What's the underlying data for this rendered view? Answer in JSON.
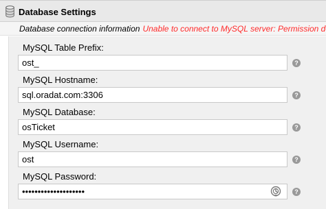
{
  "header": {
    "title": "Database Settings"
  },
  "info": {
    "label": "Database connection information",
    "error": "Unable to connect to MySQL server: Permission denied"
  },
  "fields": [
    {
      "label": "MySQL Table Prefix:",
      "value": "ost_"
    },
    {
      "label": "MySQL Hostname:",
      "value": "sql.oradat.com:3306"
    },
    {
      "label": "MySQL Database:",
      "value": "osTicket"
    },
    {
      "label": "MySQL Username:",
      "value": "ost"
    },
    {
      "label": "MySQL Password:",
      "value": "••••••••••••••••••••"
    }
  ],
  "help_icon_glyph": "?",
  "icons": {
    "header": "database-icon",
    "help": "help-icon",
    "password_reveal": "password-reveal-icon"
  },
  "colors": {
    "error": "#ff2a2a",
    "header_bg": "#e9e9e9",
    "panel_bg": "#f0f0f0",
    "help_icon": "#999999"
  }
}
